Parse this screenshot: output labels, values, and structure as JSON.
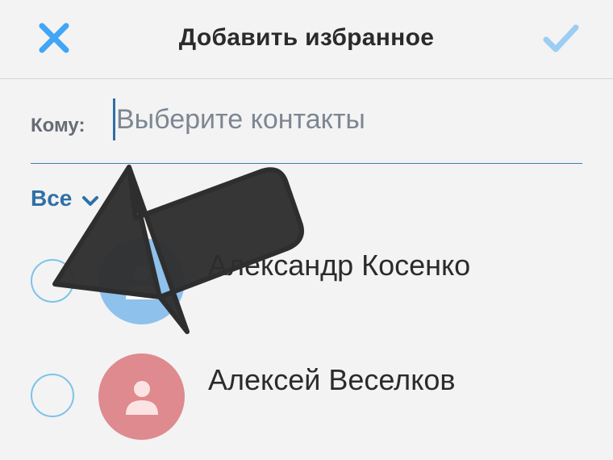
{
  "header": {
    "title": "Добавить избранное",
    "close_icon": "close-icon",
    "confirm_icon": "checkmark-icon",
    "accent_color": "#42a5f5"
  },
  "recipient": {
    "label": "Кому:",
    "placeholder": "Выберите контакты"
  },
  "filter": {
    "label": "Все",
    "icon": "chevron-down-icon"
  },
  "contacts": [
    {
      "name": "Александр Косенко",
      "avatar_color": "#8ec1ec",
      "selected": false
    },
    {
      "name": "Алексей Веселков",
      "avatar_color": "#de8a8e",
      "selected": false
    }
  ],
  "overlay": {
    "icon": "pointer-arrow-icon",
    "color": "#2e2e2e"
  }
}
